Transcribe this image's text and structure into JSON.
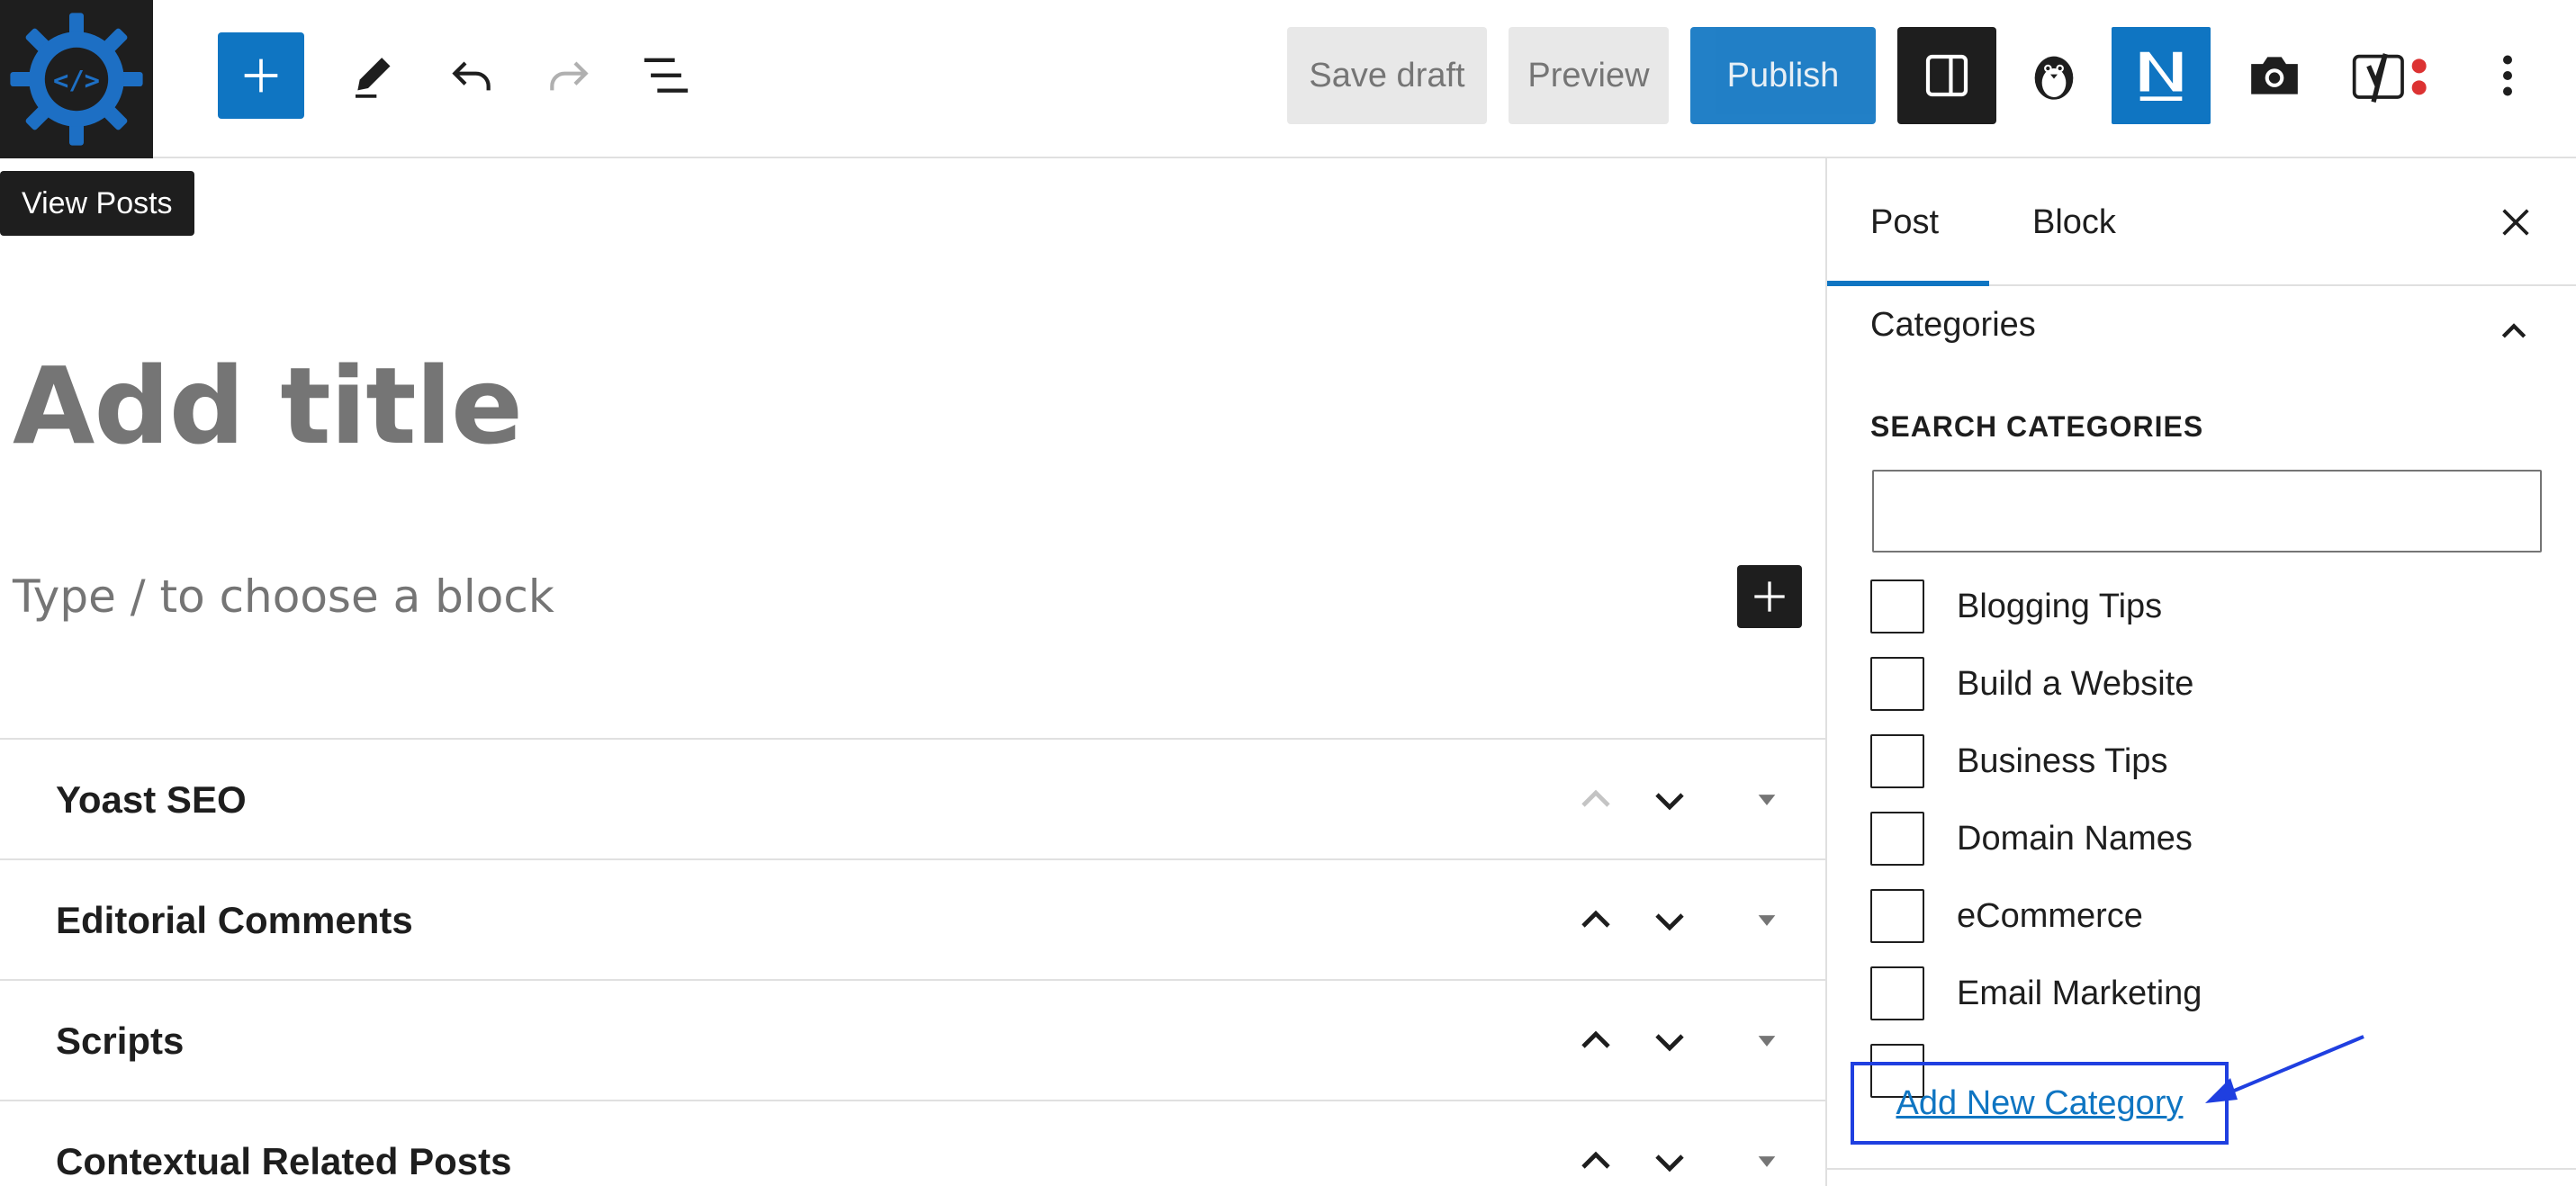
{
  "tooltip": {
    "text": "View Posts"
  },
  "toolbar": {
    "save_draft": "Save draft",
    "preview": "Preview",
    "publish": "Publish",
    "icons": [
      "site-logo-icon",
      "plus-icon",
      "pencil-icon",
      "undo-icon",
      "redo-icon",
      "list-view-icon",
      "sidebar-toggle-icon",
      "penguin-icon",
      "n-logo-icon",
      "camera-icon",
      "yoast-icon",
      "more-vertical-icon"
    ]
  },
  "editor": {
    "title_placeholder": "Add title",
    "block_placeholder": "Type / to choose a block"
  },
  "metaboxes": [
    {
      "title": "Yoast SEO",
      "up_disabled": true
    },
    {
      "title": "Editorial Comments",
      "up_disabled": false
    },
    {
      "title": "Scripts",
      "up_disabled": false
    },
    {
      "title": "Contextual Related Posts",
      "up_disabled": false
    }
  ],
  "sidebar": {
    "tabs": [
      "Post",
      "Block"
    ],
    "active_tab": "Post",
    "categories": {
      "header": "Categories",
      "search_label": "SEARCH CATEGORIES",
      "search_value": "",
      "items": [
        {
          "label": "Blogging Tips",
          "checked": false
        },
        {
          "label": "Build a Website",
          "checked": false
        },
        {
          "label": "Business Tips",
          "checked": false
        },
        {
          "label": "Domain Names",
          "checked": false
        },
        {
          "label": "eCommerce",
          "checked": false
        },
        {
          "label": "Email Marketing",
          "checked": false
        }
      ],
      "add_new_label": "Add New Category"
    }
  },
  "colors": {
    "accent": "#0f75c2",
    "dark": "#1e1e1e",
    "muted": "#757575",
    "annotation": "#1f3fe0"
  }
}
